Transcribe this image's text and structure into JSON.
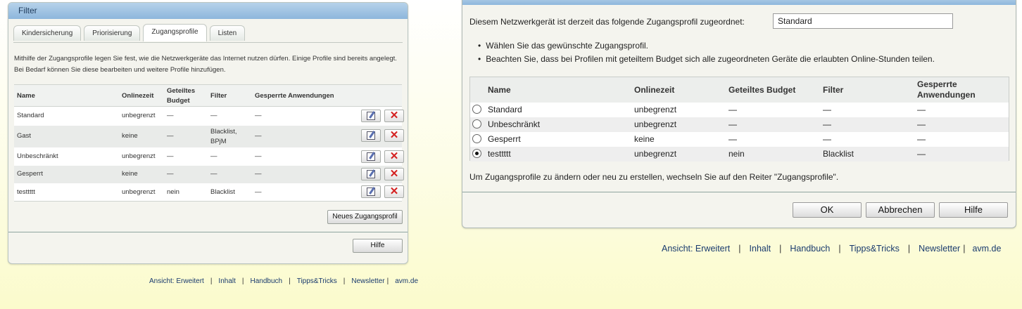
{
  "left": {
    "title": "Filter",
    "tabs": [
      "Kindersicherung",
      "Priorisierung",
      "Zugangsprofile",
      "Listen"
    ],
    "intro_line1": "Mithilfe der Zugangsprofile legen Sie fest, wie die Netzwerkgeräte das Internet nutzen dürfen. Einige Profile sind bereits angelegt.",
    "intro_line2": "Bei Bedarf können Sie diese bearbeiten und weitere Profile hinzufügen.",
    "headers": {
      "name": "Name",
      "onlinezeit": "Onlinezeit",
      "budget_1": "Geteiltes",
      "budget_2": "Budget",
      "filter": "Filter",
      "apps": "Gesperrte Anwendungen"
    },
    "rows": [
      {
        "name": "Standard",
        "onlinezeit": "unbegrenzt",
        "budget": "—",
        "filter": "—",
        "filter2": "",
        "apps": "—"
      },
      {
        "name": "Gast",
        "onlinezeit": "keine",
        "budget": "—",
        "filter": "Blacklist,",
        "filter2": "BPjM",
        "apps": "—"
      },
      {
        "name": "Unbeschränkt",
        "onlinezeit": "unbegrenzt",
        "budget": "—",
        "filter": "—",
        "filter2": "",
        "apps": "—"
      },
      {
        "name": "Gesperrt",
        "onlinezeit": "keine",
        "budget": "—",
        "filter": "—",
        "filter2": "",
        "apps": "—"
      },
      {
        "name": "testtttt",
        "onlinezeit": "unbegrenzt",
        "budget": "nein",
        "filter": "Blacklist",
        "filter2": "",
        "apps": "—"
      }
    ],
    "new_profile_button": "Neues Zugangsprofil",
    "help_button": "Hilfe",
    "footer": {
      "ansicht": "Ansicht: Erweitert",
      "inhalt": "Inhalt",
      "handbuch": "Handbuch",
      "tipps": "Tipps&Tricks",
      "newsletter": "Newsletter",
      "avm": "avm.de",
      "sep": "|"
    },
    "icons": {
      "edit": "edit-icon",
      "delete": "delete-icon"
    }
  },
  "right": {
    "assign_label": "Diesem Netzwerkgerät ist derzeit das folgende Zugangsprofil zugeordnet:",
    "assign_value": "Standard",
    "bullets": [
      "Wählen Sie das gewünschte Zugangsprofil.",
      "Beachten Sie, dass bei Profilen mit geteiltem Budget sich alle zugeordneten Geräte die erlaubten Online-Stunden teilen."
    ],
    "headers": {
      "name": "Name",
      "onlinezeit": "Onlinezeit",
      "budget": "Geteiltes Budget",
      "filter": "Filter",
      "apps_1": "Gesperrte",
      "apps_2": "Anwendungen"
    },
    "rows": [
      {
        "name": "Standard",
        "onlinezeit": "unbegrenzt",
        "budget": "—",
        "filter": "—",
        "apps": "—",
        "selected": false
      },
      {
        "name": "Unbeschränkt",
        "onlinezeit": "unbegrenzt",
        "budget": "—",
        "filter": "—",
        "apps": "—",
        "selected": false
      },
      {
        "name": "Gesperrt",
        "onlinezeit": "keine",
        "budget": "—",
        "filter": "—",
        "apps": "—",
        "selected": false
      },
      {
        "name": "testtttt",
        "onlinezeit": "unbegrenzt",
        "budget": "nein",
        "filter": "Blacklist",
        "apps": "—",
        "selected": true
      }
    ],
    "change_hint": "Um Zugangsprofile zu ändern oder neu zu erstellen, wechseln Sie auf den Reiter \"Zugangsprofile\".",
    "buttons": {
      "ok": "OK",
      "cancel": "Abbrechen",
      "help": "Hilfe"
    },
    "footer": {
      "ansicht": "Ansicht: Erweitert",
      "inhalt": "Inhalt",
      "handbuch": "Handbuch",
      "tipps": "Tipps&Tricks",
      "newsletter": "Newsletter",
      "avm": "avm.de",
      "sep": "|"
    }
  },
  "colors": {
    "title_bar": "#8db6dc",
    "link": "#1a3b6e",
    "delete": "#d42020"
  }
}
